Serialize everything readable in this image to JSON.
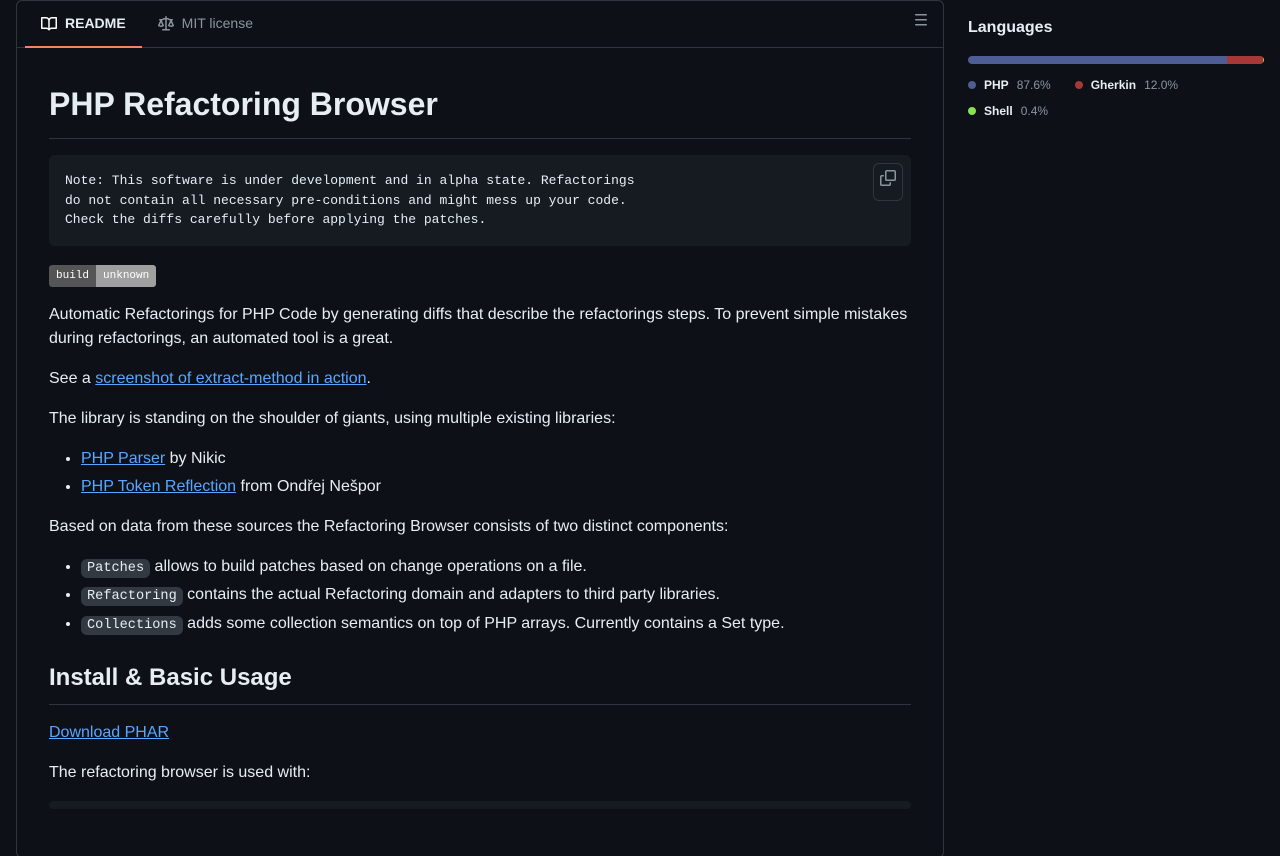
{
  "tabs": {
    "readme": "README",
    "license": "MIT license"
  },
  "readme": {
    "title": "PHP Refactoring Browser",
    "note": "Note: This software is under development and in alpha state. Refactorings\ndo not contain all necessary pre-conditions and might mess up your code.\nCheck the diffs carefully before applying the patches.",
    "badge": {
      "label": "build",
      "value": "unknown"
    },
    "p1": "Automatic Refactorings for PHP Code by generating diffs that describe the refactorings steps. To prevent simple mistakes during refactorings, an automated tool is a great.",
    "p2_before": "See a ",
    "p2_link": "screenshot of extract-method in action",
    "p2_after": ".",
    "p3": "The library is standing on the shoulder of giants, using multiple existing libraries:",
    "libs": [
      {
        "link": "PHP Parser",
        "rest": " by Nikic"
      },
      {
        "link": "PHP Token Reflection",
        "rest": " from Ondřej Nešpor"
      }
    ],
    "p4": "Based on data from these sources the Refactoring Browser consists of two distinct components:",
    "components": [
      {
        "code": "Patches",
        "rest": " allows to build patches based on change operations on a file."
      },
      {
        "code": "Refactoring",
        "rest": " contains the actual Refactoring domain and adapters to third party libraries."
      },
      {
        "code": "Collections",
        "rest": " adds some collection semantics on top of PHP arrays. Currently contains a Set type."
      }
    ],
    "h2_install": "Install & Basic Usage",
    "download_link": "Download PHAR",
    "p5": "The refactoring browser is used with:"
  },
  "languages": {
    "heading": "Languages",
    "items": [
      {
        "name": "PHP",
        "pct": "87.6%",
        "color": "#4F5D95",
        "width": "87.6%"
      },
      {
        "name": "Gherkin",
        "pct": "12.0%",
        "color": "#a83838",
        "width": "12.0%"
      },
      {
        "name": "Shell",
        "pct": "0.4%",
        "color": "#89e051",
        "width": "0.4%"
      }
    ]
  }
}
